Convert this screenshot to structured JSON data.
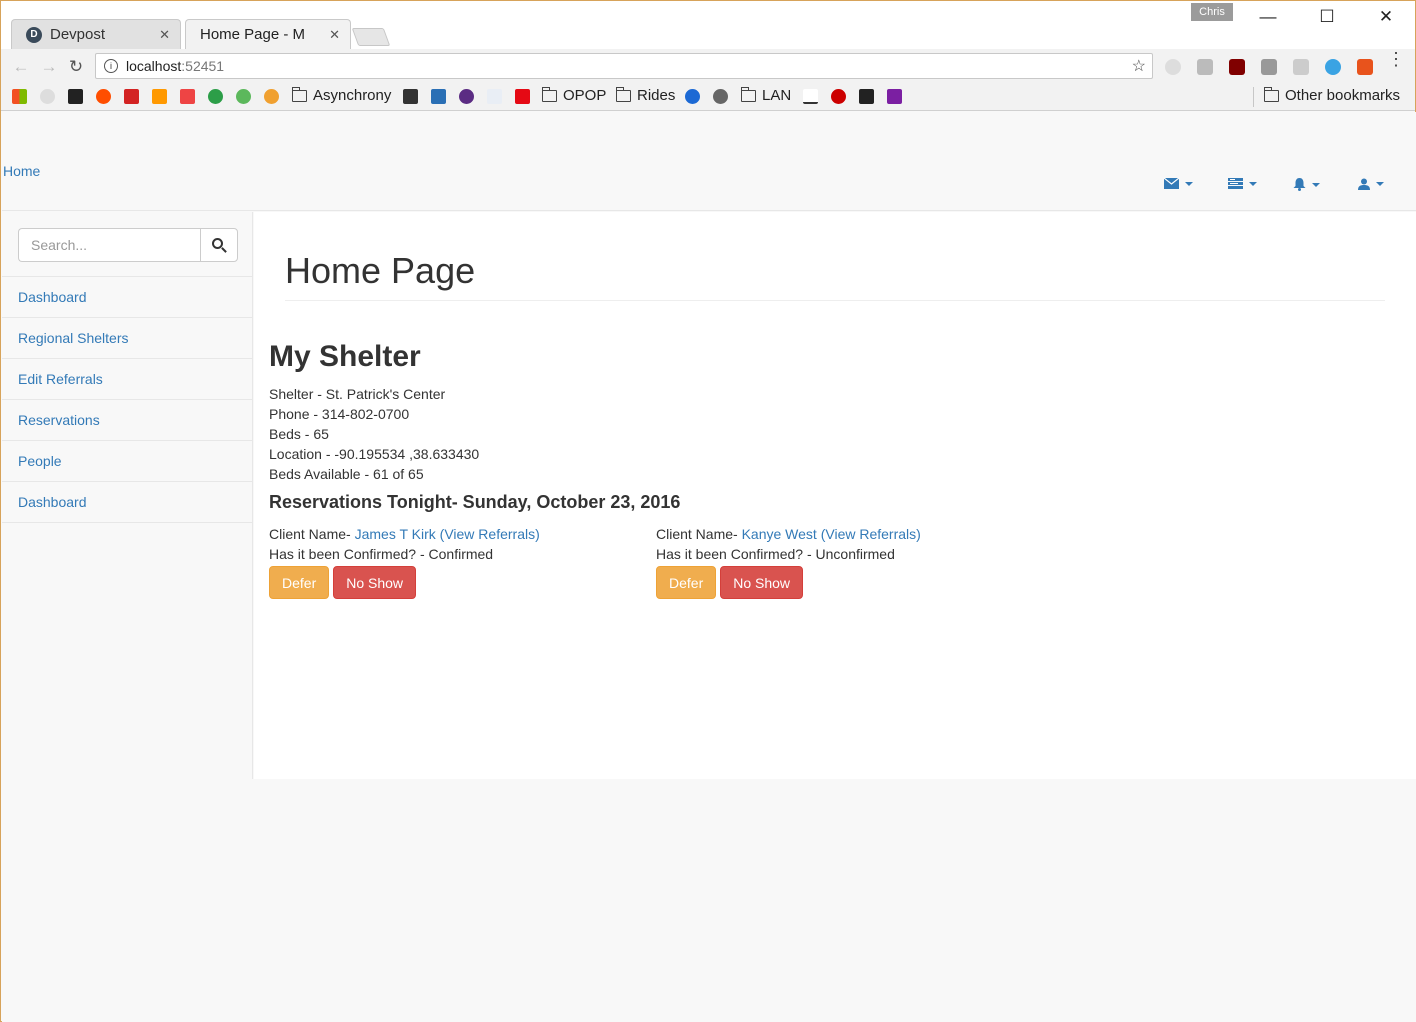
{
  "browser": {
    "tabs": [
      {
        "label": "Devpost",
        "favicon": "D"
      },
      {
        "label": "Home Page - M"
      }
    ],
    "profile": "Chris",
    "address": {
      "host": "localhost",
      "port": ":52451"
    },
    "bookmarks": {
      "folders": [
        "Asynchrony",
        "OPOP",
        "Rides",
        "LAN"
      ],
      "other": "Other bookmarks"
    }
  },
  "app": {
    "brand": "Home",
    "nav_icons": [
      "envelope-icon",
      "tasks-icon",
      "bell-icon",
      "user-icon"
    ],
    "search": {
      "placeholder": "Search..."
    },
    "sidebar": [
      "Dashboard",
      "Regional Shelters",
      "Edit Referrals",
      "Reservations",
      "People",
      "Dashboard"
    ],
    "page_title": "Home Page",
    "section_title": "My Shelter",
    "shelter_info": [
      "Shelter - St. Patrick's Center",
      "Phone - 314-802-0700",
      "Beds - 65",
      "Location - -90.195534 ,38.633430",
      "Beds Available - 61 of 65"
    ],
    "reservations_title": "Reservations Tonight- Sunday, October 23, 2016",
    "clients": [
      {
        "label": "Client Name- ",
        "name": "James T Kirk",
        "link": "(View Referrals)",
        "confirmed": "Has it been Confirmed? - Confirmed",
        "defer": "Defer",
        "noshow": "No Show"
      },
      {
        "label": "Client Name- ",
        "name": "Kanye West",
        "link": "(View Referrals)",
        "confirmed": "Has it been Confirmed? - Unconfirmed",
        "defer": "Defer",
        "noshow": "No Show"
      }
    ]
  },
  "colors": {
    "link": "#337ab7",
    "warning": "#f0ad4e",
    "danger": "#d9534f"
  }
}
